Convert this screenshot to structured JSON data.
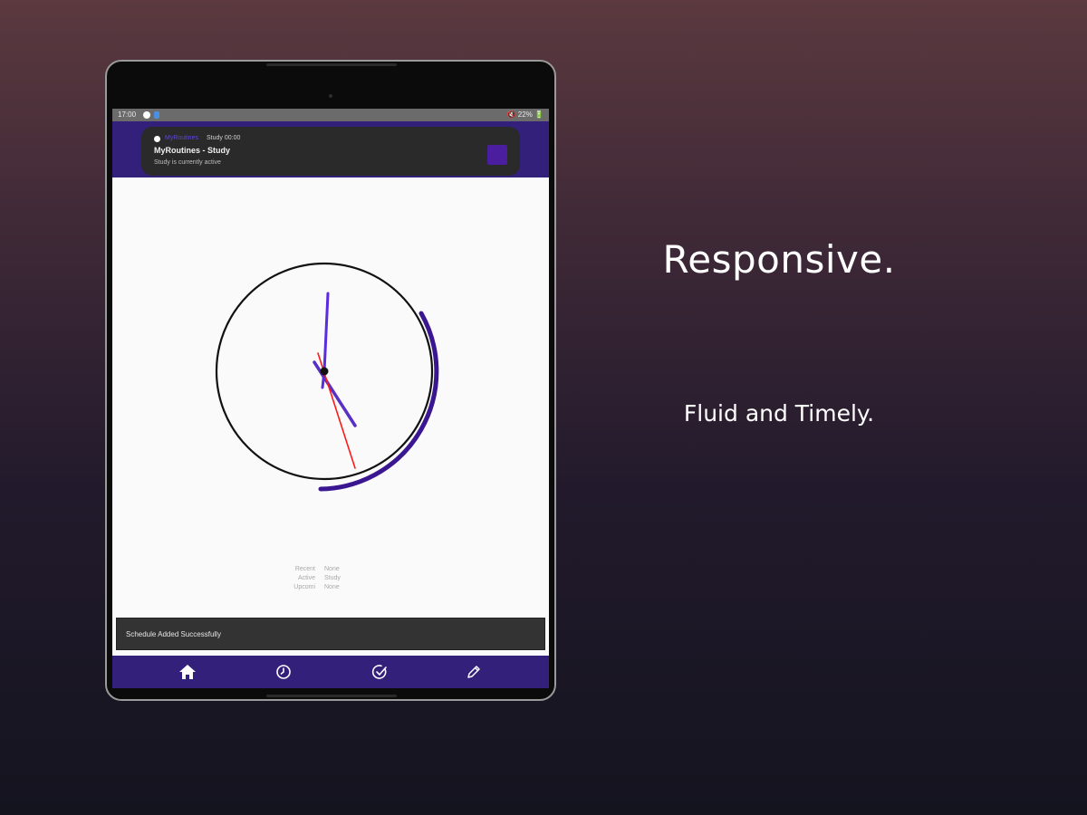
{
  "marketing": {
    "headline": "Responsive.",
    "subhead": "Fluid and Timely."
  },
  "statusbar": {
    "time": "17:00",
    "right": "🔇 22% 🔋"
  },
  "notification": {
    "app_name": "MyRoutines",
    "meta": "Study 00:00",
    "title": "MyRoutines - Study",
    "body": "Study is currently active",
    "accent_color": "#4a1e9e"
  },
  "clock": {
    "face_color": "#111111",
    "arc_color": "#3a1690",
    "hour_hand_color": "#5a2fc4",
    "minute_hand_color": "#5b2be0",
    "second_hand_color": "#ff1a1a",
    "time": "17:00"
  },
  "routine_info": [
    {
      "label": "Recent",
      "value": "None"
    },
    {
      "label": "Active",
      "value": "Study"
    },
    {
      "label": "Upcomi",
      "value": "None"
    }
  ],
  "snackbar": {
    "message": "Schedule Added Successfully"
  },
  "nav": {
    "items": [
      {
        "icon": "home-icon",
        "label": "Home"
      },
      {
        "icon": "clock-icon",
        "label": "Schedule"
      },
      {
        "icon": "check-icon",
        "label": "Tasks"
      },
      {
        "icon": "edit-icon",
        "label": "Edit"
      }
    ],
    "background": "#33207a"
  }
}
